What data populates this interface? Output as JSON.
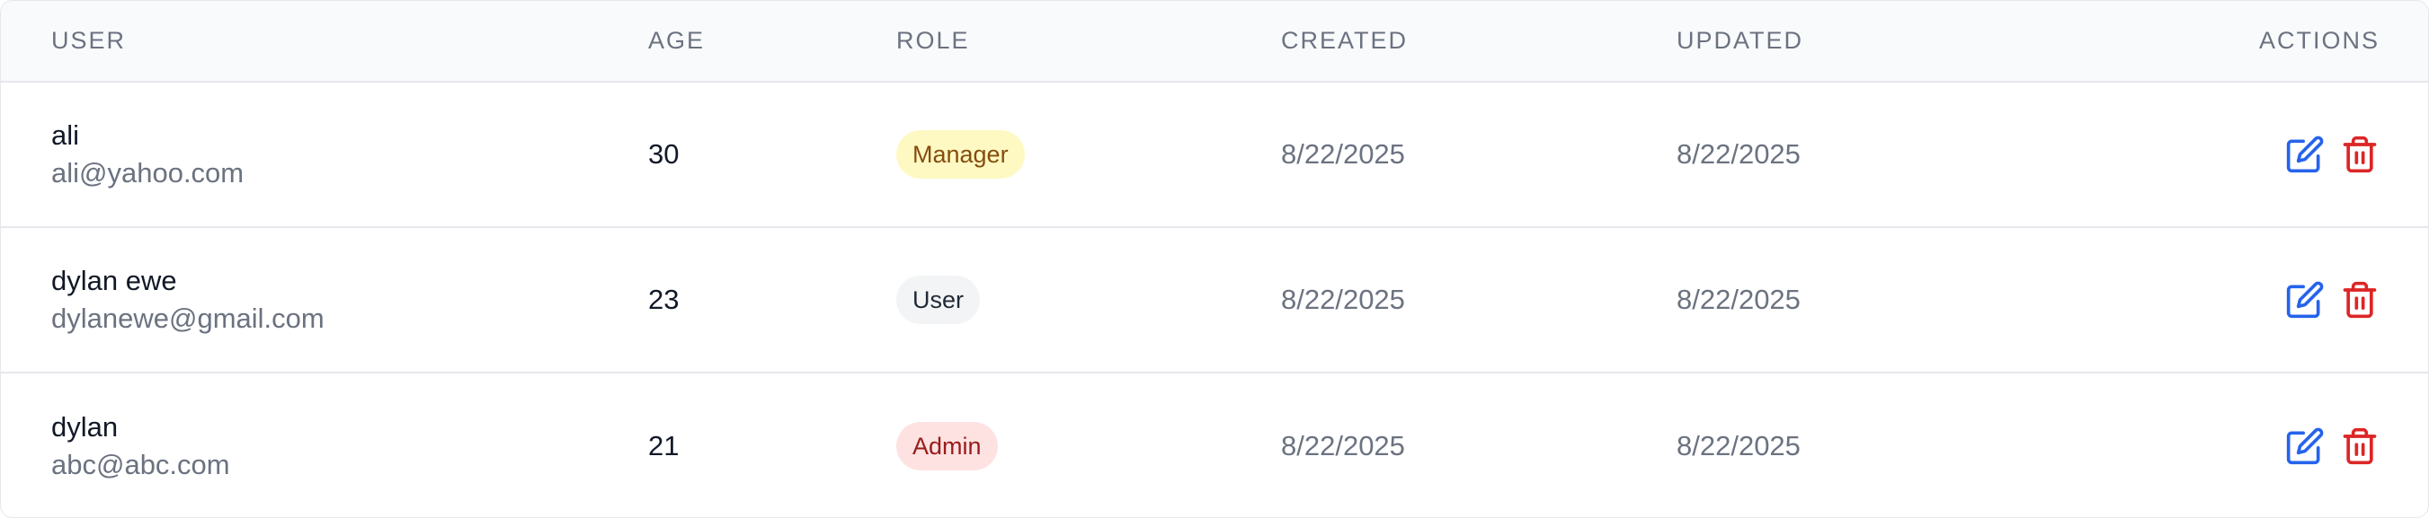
{
  "table": {
    "headers": {
      "user": "USER",
      "age": "AGE",
      "role": "ROLE",
      "created": "CREATED",
      "updated": "UPDATED",
      "actions": "ACTIONS"
    },
    "rows": [
      {
        "name": "ali",
        "email": "ali@yahoo.com",
        "age": "30",
        "role": "Manager",
        "created": "8/22/2025",
        "updated": "8/22/2025"
      },
      {
        "name": "dylan ewe",
        "email": "dylanewe@gmail.com",
        "age": "23",
        "role": "User",
        "created": "8/22/2025",
        "updated": "8/22/2025"
      },
      {
        "name": "dylan",
        "email": "abc@abc.com",
        "age": "21",
        "role": "Admin",
        "created": "8/22/2025",
        "updated": "8/22/2025"
      }
    ]
  },
  "icons": {
    "edit": "edit-icon",
    "delete": "trash-icon"
  },
  "colors": {
    "edit_icon": "#2563eb",
    "delete_icon": "#dc2626",
    "badge_manager_bg": "#fef9c3",
    "badge_manager_text": "#854d0e",
    "badge_user_bg": "#f3f4f6",
    "badge_user_text": "#1f2937",
    "badge_admin_bg": "#fee2e2",
    "badge_admin_text": "#991b1b"
  }
}
